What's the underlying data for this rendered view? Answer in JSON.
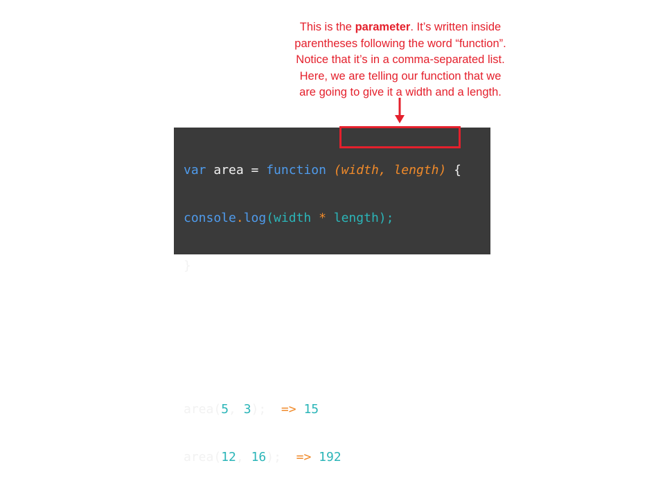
{
  "annotation": {
    "line1_pre": "This is the ",
    "line1_bold": "parameter",
    "line1_post": ". It’s written inside",
    "line2": "parentheses following the word “function”.",
    "line3": "Notice that it’s in a comma-separated list.",
    "line4": "Here, we are telling our function that we",
    "line5": "are going to give it a width and a length."
  },
  "code": {
    "line1": {
      "var": "var",
      "name": " area = ",
      "function": "function",
      "space": " ",
      "params": "(width, length)",
      "brace": " {"
    },
    "line2": {
      "console": "console",
      "dot": ".",
      "log": "log",
      "open": "(width ",
      "star": "*",
      "close": " length);"
    },
    "line3": "}",
    "line4": {
      "call": "area(",
      "a": "5",
      "comma": ", ",
      "b": "3",
      "end": ");  ",
      "arrow": "=>",
      "result": " 15"
    },
    "line5": {
      "call": "area(",
      "a": "12",
      "comma": ", ",
      "b": "16",
      "end": ");  ",
      "arrow": "=>",
      "result": " 192"
    }
  },
  "colors": {
    "annotation_red": "#e4202c",
    "panel_bg": "#3a3a3a",
    "keyword_blue": "#4f9bec",
    "param_orange": "#f08a2a",
    "number_teal": "#2bb5b8"
  }
}
